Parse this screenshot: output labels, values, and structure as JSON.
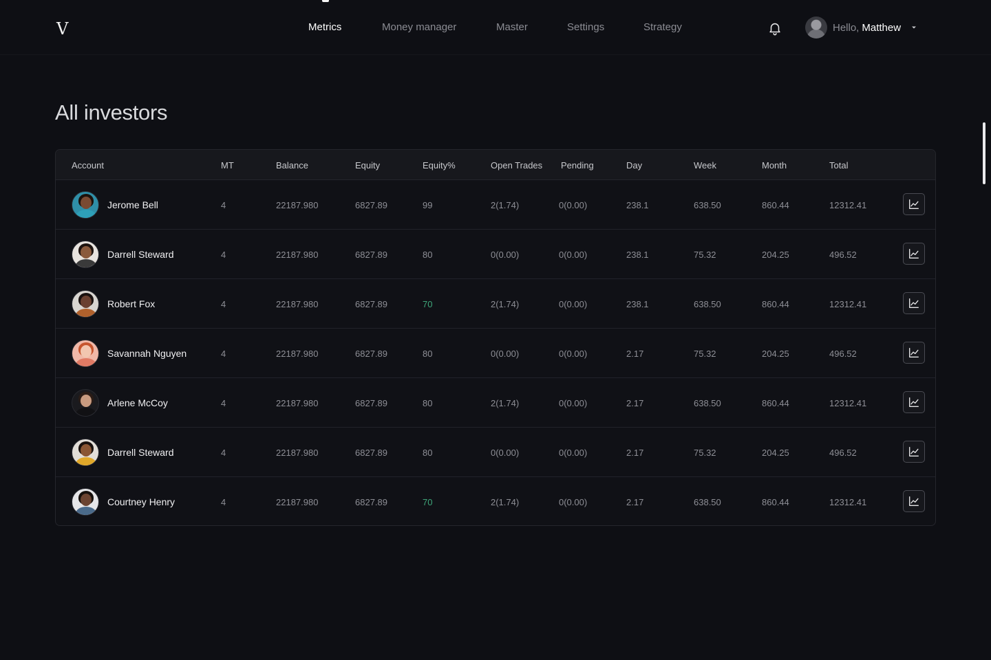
{
  "app": {
    "logo": "V"
  },
  "nav": {
    "items": [
      {
        "label": "Metrics",
        "active": true
      },
      {
        "label": "Money manager",
        "active": false
      },
      {
        "label": "Master",
        "active": false
      },
      {
        "label": "Settings",
        "active": false
      },
      {
        "label": "Strategy",
        "active": false
      }
    ]
  },
  "user": {
    "greeting": "Hello,",
    "name": "Matthew"
  },
  "page": {
    "title": "All investors"
  },
  "table": {
    "columns": [
      "Account",
      "MT",
      "Balance",
      "Equity",
      "Equity%",
      "Open Trades",
      "Pending",
      "Day",
      "Week",
      "Month",
      "Total"
    ],
    "rows": [
      {
        "name": "Jerome Bell",
        "mt": "4",
        "balance": "22187.980",
        "equity": "6827.89",
        "equity_pct": "99",
        "open_trades": "2(1.74)",
        "pending": "0(0.00)",
        "day": "238.1",
        "week": "638.50",
        "month": "860.44",
        "total": "12312.41",
        "highlight": false,
        "avatar": {
          "bg": "#2f8fa8",
          "skin": "#7a4a32",
          "hair": "#1c120c",
          "shirt": "#2ea0b8"
        }
      },
      {
        "name": "Darrell Steward",
        "mt": "4",
        "balance": "22187.980",
        "equity": "6827.89",
        "equity_pct": "80",
        "open_trades": "0(0.00)",
        "pending": "0(0.00)",
        "day": "238.1",
        "week": "75.32",
        "month": "204.25",
        "total": "496.52",
        "highlight": false,
        "avatar": {
          "bg": "#e8e4df",
          "skin": "#8a5a3c",
          "hair": "#1e1410",
          "shirt": "#3a3a3a"
        }
      },
      {
        "name": "Robert Fox",
        "mt": "4",
        "balance": "22187.980",
        "equity": "6827.89",
        "equity_pct": "70",
        "open_trades": "2(1.74)",
        "pending": "0(0.00)",
        "day": "238.1",
        "week": "638.50",
        "month": "860.44",
        "total": "12312.41",
        "highlight": true,
        "avatar": {
          "bg": "#d9d6d1",
          "skin": "#6a4030",
          "hair": "#1a1210",
          "shirt": "#b0612c"
        }
      },
      {
        "name": "Savannah Nguyen",
        "mt": "4",
        "balance": "22187.980",
        "equity": "6827.89",
        "equity_pct": "80",
        "open_trades": "0(0.00)",
        "pending": "0(0.00)",
        "day": "2.17",
        "week": "75.32",
        "month": "204.25",
        "total": "496.52",
        "highlight": false,
        "avatar": {
          "bg": "#f0b8a8",
          "skin": "#f2c6b0",
          "hair": "#c6552e",
          "shirt": "#e07a64"
        }
      },
      {
        "name": "Arlene McCoy",
        "mt": "4",
        "balance": "22187.980",
        "equity": "6827.89",
        "equity_pct": "80",
        "open_trades": "2(1.74)",
        "pending": "0(0.00)",
        "day": "2.17",
        "week": "638.50",
        "month": "860.44",
        "total": "12312.41",
        "highlight": false,
        "avatar": {
          "bg": "#1a1a1e",
          "skin": "#c99b80",
          "hair": "#2a1c16",
          "shirt": "#111114"
        }
      },
      {
        "name": "Darrell Steward",
        "mt": "4",
        "balance": "22187.980",
        "equity": "6827.89",
        "equity_pct": "80",
        "open_trades": "0(0.00)",
        "pending": "0(0.00)",
        "day": "2.17",
        "week": "75.32",
        "month": "204.25",
        "total": "496.52",
        "highlight": false,
        "avatar": {
          "bg": "#e2ded8",
          "skin": "#8a5634",
          "hair": "#1a120e",
          "shirt": "#e0a82a"
        }
      },
      {
        "name": "Courtney Henry",
        "mt": "4",
        "balance": "22187.980",
        "equity": "6827.89",
        "equity_pct": "70",
        "open_trades": "2(1.74)",
        "pending": "0(0.00)",
        "day": "2.17",
        "week": "638.50",
        "month": "860.44",
        "total": "12312.41",
        "highlight": true,
        "avatar": {
          "bg": "#e6e6e8",
          "skin": "#6b4330",
          "hair": "#16100c",
          "shirt": "#4a6a8a"
        }
      }
    ]
  },
  "colors": {
    "background": "#0e0f14",
    "positive": "#3fa67a",
    "text_muted": "#8e8f96"
  },
  "icons": {
    "notification": "bell-icon",
    "chart": "line-chart-icon",
    "user_menu": "caret-down-icon"
  }
}
